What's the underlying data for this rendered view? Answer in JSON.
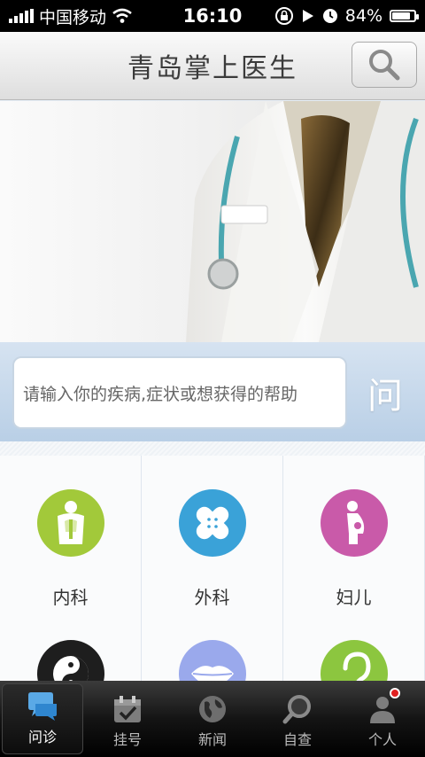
{
  "status_bar": {
    "carrier": "中国移动",
    "time": "16:10",
    "battery": "84%",
    "battery_level": 0.84
  },
  "header": {
    "title": "青岛掌上医生",
    "search_icon": "search-icon"
  },
  "ask": {
    "placeholder": "请输入你的疾病,症状或想获得的帮助",
    "button_label": "问"
  },
  "departments": [
    {
      "label": "内科",
      "icon": "internal-organs-icon",
      "color": "#a2c93a"
    },
    {
      "label": "外科",
      "icon": "bandage-icon",
      "color": "#3aa2d8"
    },
    {
      "label": "妇儿",
      "icon": "pregnant-woman-icon",
      "color": "#c95aa9"
    },
    {
      "label": "",
      "icon": "yin-yang-icon",
      "color": "#1e1e1e"
    },
    {
      "label": "",
      "icon": "lips-icon",
      "color": "#9aa9ec"
    },
    {
      "label": "",
      "icon": "ear-icon",
      "color": "#8cc63f"
    }
  ],
  "tabs": [
    {
      "label": "问诊",
      "icon": "chat-bubble-icon",
      "active": true
    },
    {
      "label": "挂号",
      "icon": "calendar-check-icon",
      "active": false
    },
    {
      "label": "新闻",
      "icon": "globe-icon",
      "active": false
    },
    {
      "label": "自查",
      "icon": "magnifier-icon",
      "active": false
    },
    {
      "label": "个人",
      "icon": "person-icon",
      "active": false,
      "badge": true
    }
  ]
}
